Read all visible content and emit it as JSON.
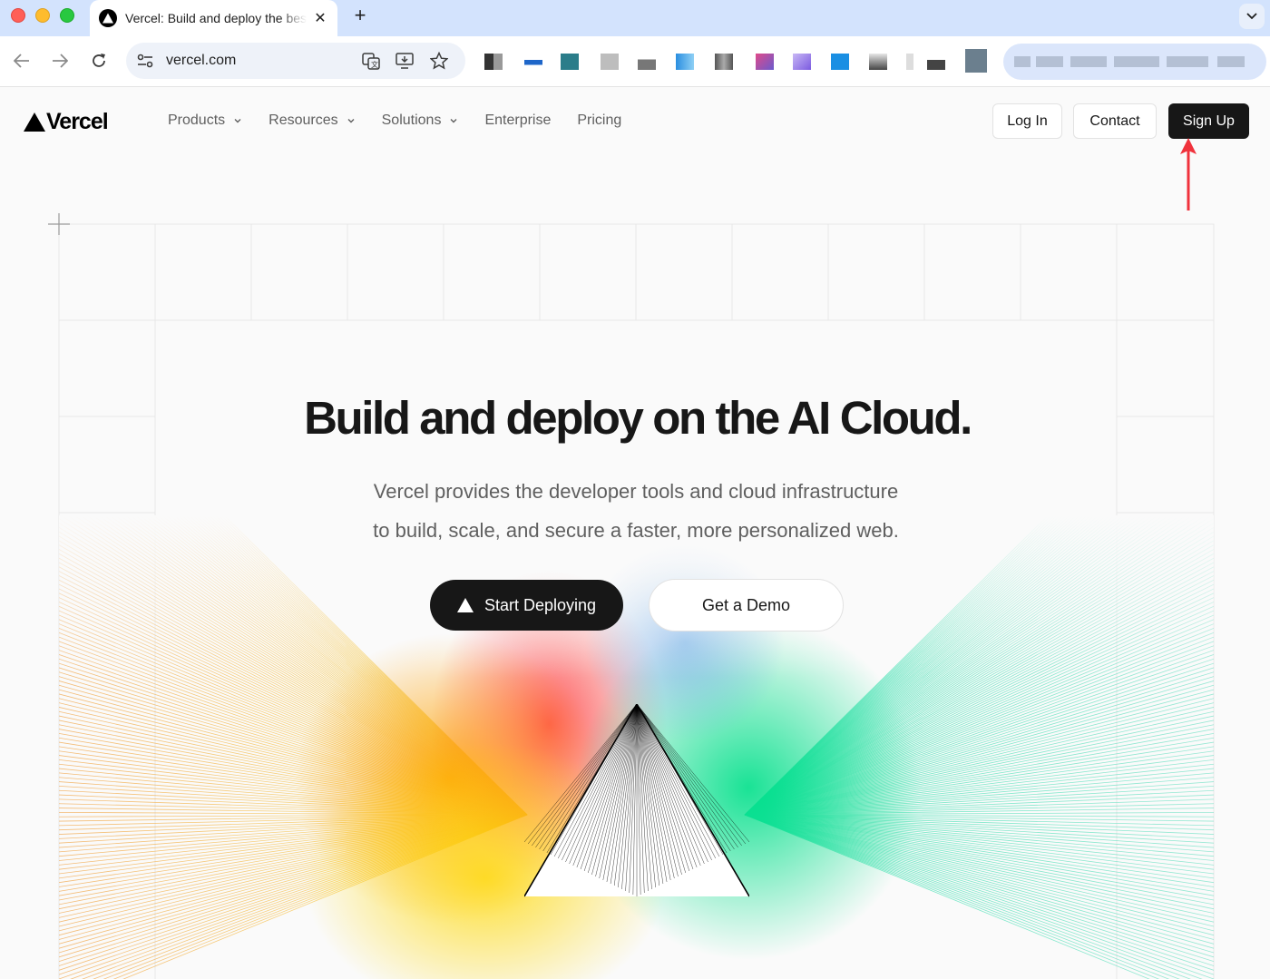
{
  "browser": {
    "tab_title": "Vercel: Build and deploy the best web experiences with the AI Cloud",
    "new_tab_label": "+",
    "url": "vercel.com"
  },
  "nav": {
    "logo_text": "Vercel",
    "menu": [
      {
        "label": "Products",
        "dropdown": true
      },
      {
        "label": "Resources",
        "dropdown": true
      },
      {
        "label": "Solutions",
        "dropdown": true
      },
      {
        "label": "Enterprise",
        "dropdown": false
      },
      {
        "label": "Pricing",
        "dropdown": false
      }
    ],
    "login_label": "Log In",
    "contact_label": "Contact",
    "signup_label": "Sign Up"
  },
  "hero": {
    "title": "Build and deploy on the AI Cloud.",
    "subtitle_line1": "Vercel provides the developer tools and cloud infrastructure",
    "subtitle_line2": "to build, scale, and secure a faster, more personalized web.",
    "primary_cta": "Start Deploying",
    "secondary_cta": "Get a Demo"
  },
  "colors": {
    "annotation_arrow": "#f0323c",
    "dark": "#171717",
    "muted_text": "#5f5f5f"
  },
  "icons": [
    "vercel-triangle-icon",
    "chevron-down-icon",
    "back-arrow-icon",
    "forward-arrow-icon",
    "reload-icon",
    "site-settings-icon",
    "translate-icon",
    "install-app-icon",
    "bookmark-star-icon",
    "tab-close-icon",
    "tab-list-icon"
  ]
}
